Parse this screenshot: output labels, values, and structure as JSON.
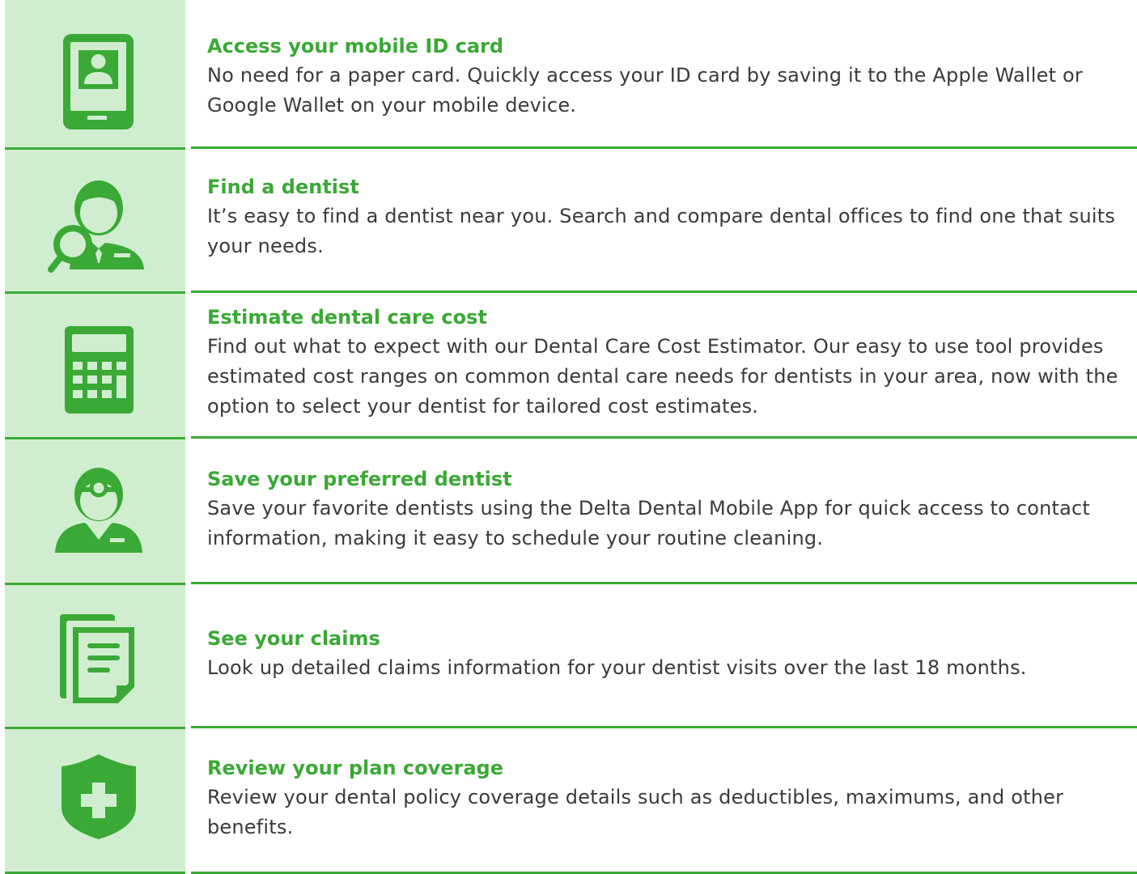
{
  "colors": {
    "accent": "#3aa935",
    "icon_background": "#d0eecf",
    "text": "#3a3a3a"
  },
  "features": [
    {
      "icon": "mobile-id-card-icon",
      "title": "Access your mobile ID card",
      "description": "No need for a paper card. Quickly access your ID card by saving it to the Apple Wallet or Google Wallet on your mobile device."
    },
    {
      "icon": "find-dentist-icon",
      "title": "Find a dentist",
      "description": "It’s easy to find a dentist near you. Search and compare dental offices to find one that suits your needs."
    },
    {
      "icon": "calculator-icon",
      "title": "Estimate dental care cost",
      "description": "Find out what to expect with our Dental Care Cost Estimator. Our easy to use tool provides estimated cost ranges on common dental care needs for dentists in your area, now with the option to select your dentist for tailored cost estimates."
    },
    {
      "icon": "dentist-icon",
      "title": "Save your preferred dentist",
      "description": "Save your favorite dentists using the Delta Dental Mobile App for quick access to contact information, making it easy to schedule your routine cleaning."
    },
    {
      "icon": "claims-documents-icon",
      "title": "See your claims",
      "description": "Look up detailed claims information for your dentist visits over the last 18 months."
    },
    {
      "icon": "shield-plus-icon",
      "title": "Review your plan coverage",
      "description": "Review your dental policy coverage details such as deductibles, maximums, and other benefits."
    }
  ]
}
